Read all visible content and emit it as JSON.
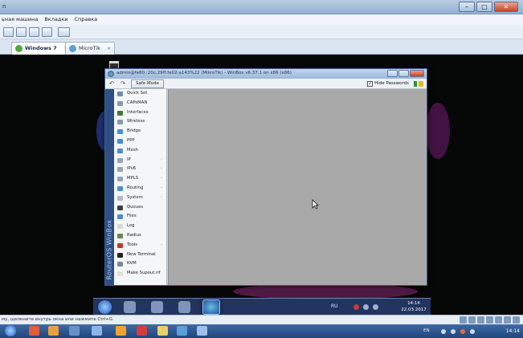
{
  "host": {
    "title": "n",
    "menu": [
      "ьная машина",
      "Вкладки",
      "Справка"
    ],
    "tabs": [
      {
        "label": "Windows 7",
        "close": "×",
        "active": true
      },
      {
        "label": "MicroTik",
        "close": "×",
        "active": false
      }
    ],
    "status_text": "му, щелкните внутрь окна или нажмите Ctrl+G.",
    "taskbar": {
      "lang": "EN",
      "clock": "14:14"
    }
  },
  "vm": {
    "taskbar": {
      "lang": "RU",
      "time": "14:14",
      "date": "22.03.2017"
    }
  },
  "winbox": {
    "title": "admin@fe80::20c:29ff:fe02:a143%22 (MikroTik) - WinBox v6.37.1 on x86 (x86)",
    "nav_back": "↶",
    "nav_forward": "↷",
    "safe_mode": "Safe Mode",
    "hide_passwords": "Hide Passwords",
    "hide_passwords_checked": "✓",
    "sidebar_label": "RouterOS WinBox",
    "menu": [
      {
        "label": "Quick Set",
        "icon": "quick-set-icon",
        "color": "#6b8db3",
        "arrow": ""
      },
      {
        "label": "CAPsMAN",
        "icon": "capsman-icon",
        "color": "#8a9aa8",
        "arrow": ""
      },
      {
        "label": "Interfaces",
        "icon": "interfaces-icon",
        "color": "#3a7a3a",
        "arrow": ""
      },
      {
        "label": "Wireless",
        "icon": "wireless-icon",
        "color": "#8a9aa8",
        "arrow": ""
      },
      {
        "label": "Bridge",
        "icon": "bridge-icon",
        "color": "#4a8fd0",
        "arrow": ""
      },
      {
        "label": "PPP",
        "icon": "ppp-icon",
        "color": "#4a8fd0",
        "arrow": ""
      },
      {
        "label": "Mesh",
        "icon": "mesh-icon",
        "color": "#4a8fd0",
        "arrow": ""
      },
      {
        "label": "IP",
        "icon": "ip-icon",
        "color": "#9aa4b0",
        "arrow": "›"
      },
      {
        "label": "IPv6",
        "icon": "ipv6-icon",
        "color": "#9aa4b0",
        "arrow": "›"
      },
      {
        "label": "MPLS",
        "icon": "mpls-icon",
        "color": "#9aa4b0",
        "arrow": "›"
      },
      {
        "label": "Routing",
        "icon": "routing-icon",
        "color": "#4a8fd0",
        "arrow": "›"
      },
      {
        "label": "System",
        "icon": "system-icon",
        "color": "#b0b8c2",
        "arrow": "›"
      },
      {
        "label": "Queues",
        "icon": "queues-icon",
        "color": "#404040",
        "arrow": ""
      },
      {
        "label": "Files",
        "icon": "files-icon",
        "color": "#4a8fd0",
        "arrow": ""
      },
      {
        "label": "Log",
        "icon": "log-icon",
        "color": "#d8d8d8",
        "arrow": ""
      },
      {
        "label": "Radius",
        "icon": "radius-icon",
        "color": "#6a8a4a",
        "arrow": ""
      },
      {
        "label": "Tools",
        "icon": "tools-icon",
        "color": "#c0392b",
        "arrow": "›"
      },
      {
        "label": "New Terminal",
        "icon": "terminal-icon",
        "color": "#222222",
        "arrow": ""
      },
      {
        "label": "KVM",
        "icon": "kvm-icon",
        "color": "#7a8a9a",
        "arrow": ""
      },
      {
        "label": "Make Supout.rif",
        "icon": "supout-icon",
        "color": "#e0e0e0",
        "arrow": ""
      }
    ]
  },
  "colors": {
    "winbox_sidebar": "#2d4f85",
    "workarea": "#a9a9a9",
    "vm_background": "#060707"
  }
}
